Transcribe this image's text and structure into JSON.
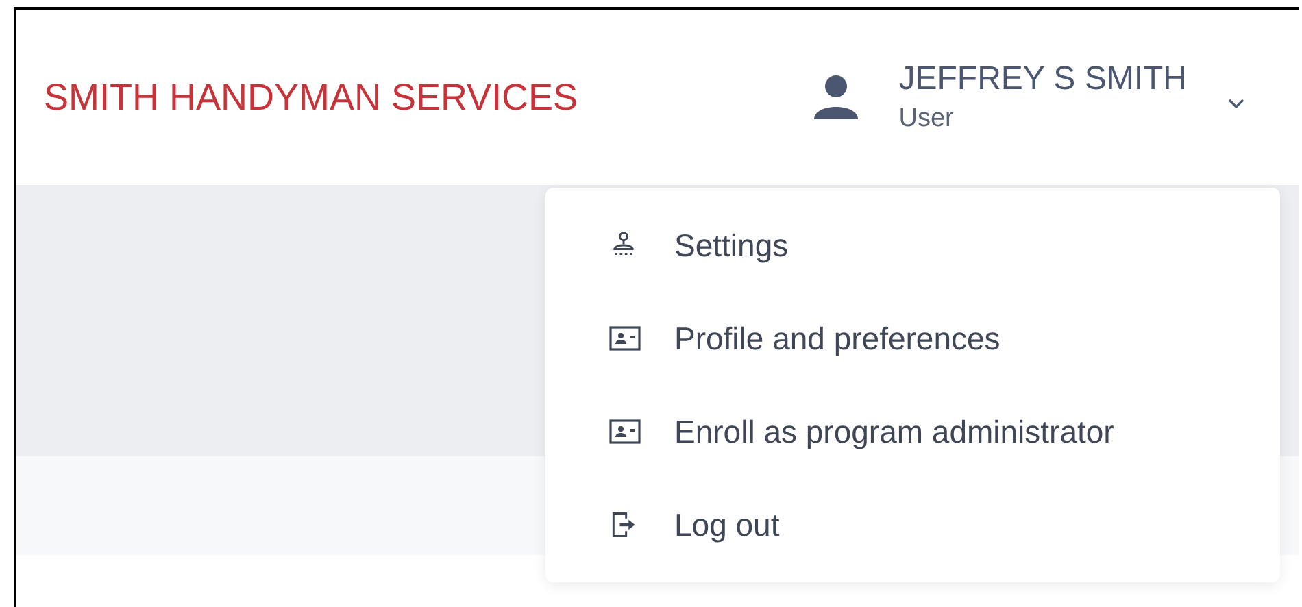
{
  "header": {
    "company": "SMITH HANDYMAN SERVICES",
    "user": {
      "name": "JEFFREY S SMITH",
      "role": "User",
      "expanded": true
    }
  },
  "user_menu": [
    {
      "label": "Settings",
      "kind": "stamp"
    },
    {
      "label": "Profile and preferences",
      "kind": "card"
    },
    {
      "label": "Enroll as program administrator",
      "kind": "card"
    },
    {
      "label": "Log out",
      "kind": "logout"
    }
  ]
}
